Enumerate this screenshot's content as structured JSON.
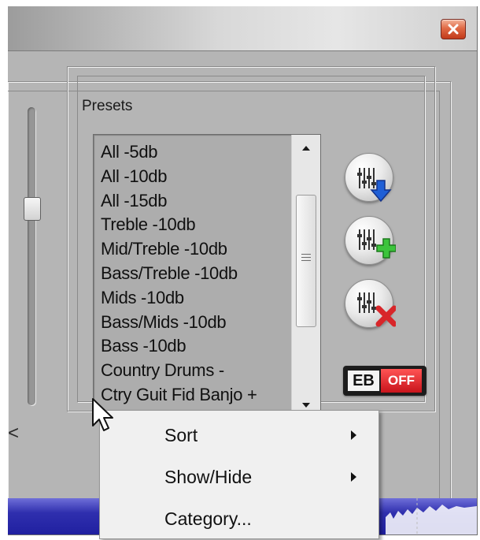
{
  "window": {
    "close_icon": "close-icon"
  },
  "presets": {
    "legend": "Presets",
    "items": [
      "All -5db",
      "All -10db",
      "All -15db",
      "Treble -10db",
      "Mid/Treble -10db",
      "Bass/Treble -10db",
      "Mids -10db",
      "Bass/Mids -10db",
      "Bass -10db",
      "Country Drums -",
      "Ctry Guit Fid Banjo +"
    ]
  },
  "side_glyph": "<",
  "buttons": {
    "load_preset_icon": "eq-download-icon",
    "add_preset_icon": "eq-add-icon",
    "delete_preset_icon": "eq-delete-icon"
  },
  "eb_toggle": {
    "label": "EB",
    "state": "OFF"
  },
  "context_menu": {
    "items": [
      {
        "label": "Sort",
        "has_submenu": true
      },
      {
        "label": "Show/Hide",
        "has_submenu": true
      },
      {
        "label": "Category...",
        "has_submenu": false
      }
    ]
  },
  "colors": {
    "accent_blue": "#2f2fae",
    "close_red": "#d9522c",
    "toggle_red": "#e02228"
  }
}
